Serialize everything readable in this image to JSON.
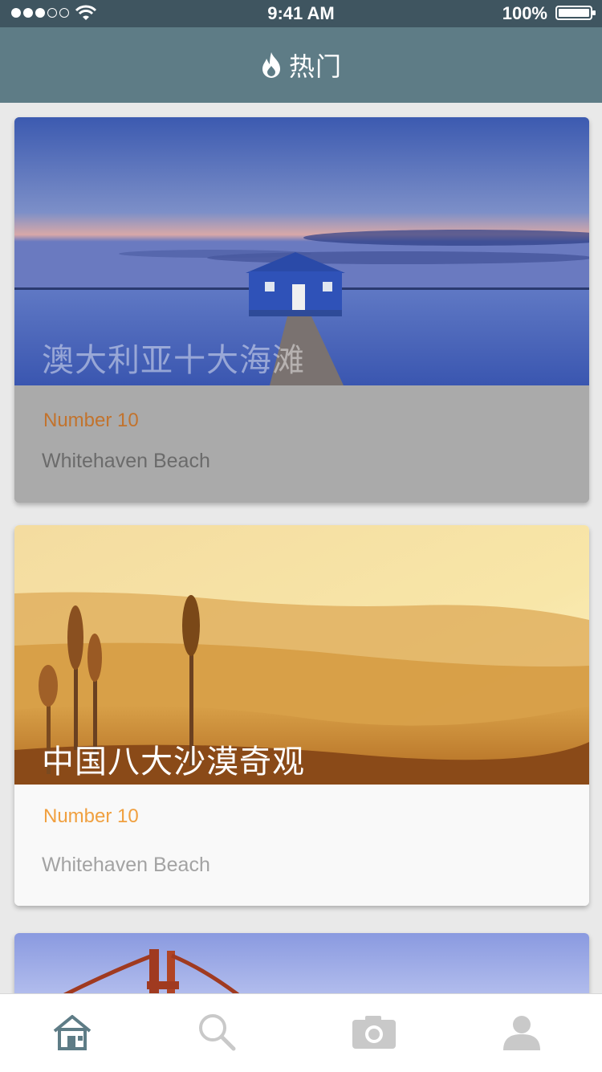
{
  "status_bar": {
    "time": "9:41 AM",
    "battery": "100%",
    "signal_filled": 3,
    "signal_total": 5
  },
  "nav": {
    "icon": "flame-icon",
    "title": "热门"
  },
  "cards": [
    {
      "image": "blue-boathouse-lake-photo",
      "title": "澳大利亚十大海滩",
      "number": "Number 10",
      "name": "Whitehaven Beach"
    },
    {
      "image": "golden-desert-sunset-reeds-photo",
      "title": "中国八大沙漠奇观",
      "number": "Number 10",
      "name": "Whitehaven Beach"
    },
    {
      "image": "golden-gate-bridge-photo"
    }
  ],
  "tabbar": {
    "tabs": [
      {
        "icon": "home-icon",
        "active": true
      },
      {
        "icon": "search-icon",
        "active": false
      },
      {
        "icon": "camera-icon",
        "active": false
      },
      {
        "icon": "user-icon",
        "active": false
      }
    ]
  },
  "colors": {
    "status_bar_bg": "#3f5560",
    "nav_bg": "#5e7c86",
    "accent_orange": "#f0a040",
    "active_tab": "#5e7c86",
    "inactive_tab": "#c9c9c9"
  }
}
